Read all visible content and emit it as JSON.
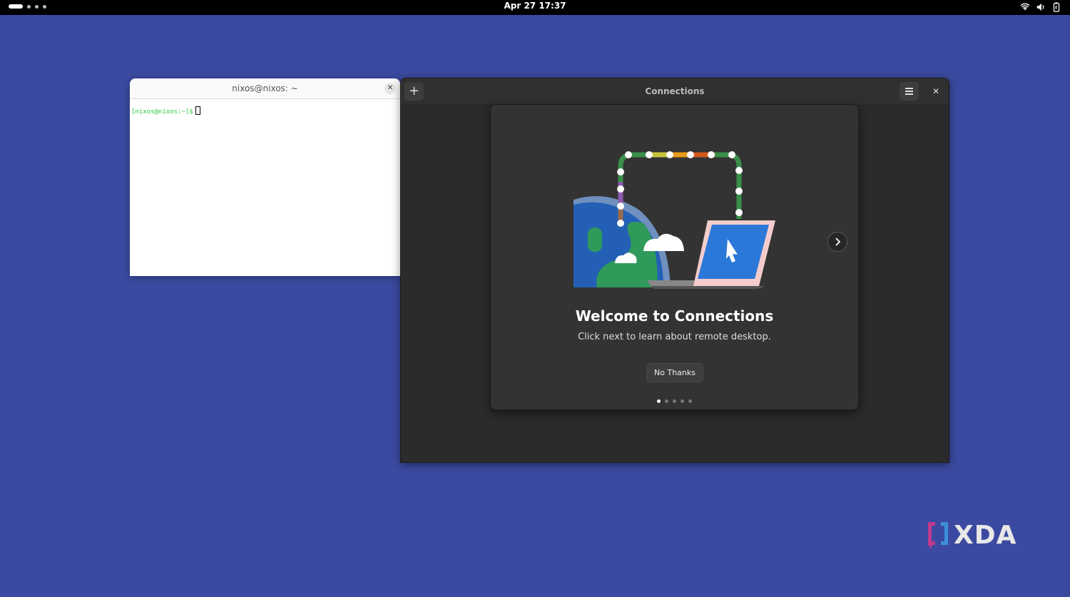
{
  "topbar": {
    "clock": "Apr 27  17:37"
  },
  "terminal": {
    "title": "nixos@nixos: ~",
    "prompt": "[nixos@nixos:~]$"
  },
  "connections": {
    "title": "Connections",
    "welcome_title": "Welcome to Connections",
    "welcome_subtitle": "Click next to learn about remote desktop.",
    "no_thanks_label": "No Thanks",
    "page_count": 5,
    "active_page": 1
  },
  "watermark": {
    "text": "XDA"
  },
  "colors": {
    "desktop": "#3b4aa0",
    "dialog": "#333333",
    "prompt_green": "#2ecc40"
  }
}
